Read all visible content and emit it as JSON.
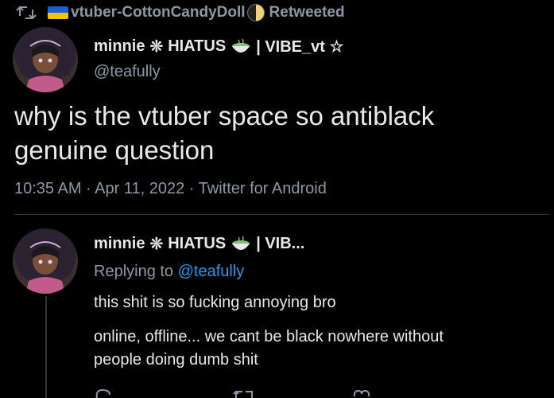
{
  "retweet": {
    "icon": "retweet-icon",
    "flag_icon": "ukraine-flag-icon",
    "user": "vtuber-CottonCandyDoll",
    "moon_icon": "half-moon-icon",
    "label": "Retweeted"
  },
  "tweet": {
    "display_name_prefix": "minnie",
    "sparkle": "❊",
    "name_middle": "HIATUS",
    "matcha_icon": "matcha-bowl-icon",
    "name_suffix": "| VIBE_vt ☆",
    "handle": "@teafully",
    "text_line1": "why is the vtuber space so antiblack",
    "text_line2": "genuine question",
    "meta": "10:35 AM · Apr 11, 2022 · Twitter for Android"
  },
  "reply": {
    "display_name_prefix": "minnie",
    "sparkle": "❊",
    "name_middle": "HIATUS",
    "name_suffix": "| VIB...",
    "replying_label": "Replying to",
    "replying_handle": "@teafully",
    "text1": "this shit is so fucking annoying bro",
    "text2_line1": "online, offline... we cant be black nowhere without",
    "text2_line2": "people doing dumb shit"
  },
  "colors": {
    "background": "#000000",
    "text": "#e7e9ea",
    "muted": "#8b98a5",
    "link": "#1d9bf0"
  }
}
